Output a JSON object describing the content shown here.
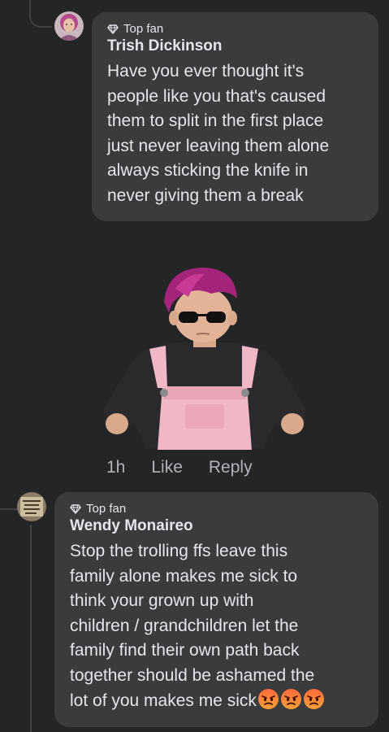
{
  "comments": [
    {
      "badge": "Top fan",
      "author": "Trish Dickinson",
      "text": "Have you ever thought it's people like you that's caused them to split in the first place just never leaving them alone always sticking the knife in never giving them a break",
      "lines": [
        "Have you ever thought it's",
        "people like you that's caused",
        "them to split in the first place",
        "just never leaving them alone",
        "always sticking the knife in",
        "never giving them a break"
      ],
      "timestamp": "1h",
      "like_label": "Like",
      "reply_label": "Reply"
    },
    {
      "badge": "Top fan",
      "author": "Wendy Monaireo",
      "lines": [
        "Stop the trolling ffs leave this",
        "family alone makes me sick to",
        "think your grown up with",
        "children / grandchildren let the",
        "family find their own path back",
        "together should be ashamed the",
        "lot of you makes me sick"
      ],
      "emojis": [
        "angry-face",
        "angry-face",
        "angry-face"
      ],
      "avatar_sign_text": "BUT MY WHOLE ASS BACK"
    }
  ],
  "colors": {
    "background": "#242526",
    "bubble": "#3a3b3c",
    "text": "#e4e6eb",
    "secondary_text": "#b0b3b8",
    "thread_line": "#3e4042"
  },
  "icons": [
    "top-fan-diamond-icon",
    "angry-face-emoji"
  ]
}
